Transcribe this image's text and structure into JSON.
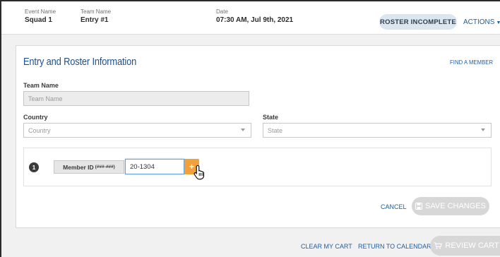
{
  "header": {
    "event_label": "Event Name",
    "event_value": "Squad 1",
    "team_label": "Team Name",
    "team_value": "Entry #1",
    "date_label": "Date",
    "date_value": "07:30 AM, Jul 9th, 2021",
    "status_badge": "ROSTER INCOMPLETE",
    "actions_label": "ACTIONS"
  },
  "card": {
    "title": "Entry and Roster Information",
    "find_member": "FIND A MEMBER",
    "team_name_label": "Team Name",
    "team_name_placeholder": "Team Name",
    "country_label": "Country",
    "country_value": "Country",
    "state_label": "State",
    "state_value": "State"
  },
  "member": {
    "number": "1",
    "label": "Member ID",
    "format": "(###-###)",
    "value": "20-1304",
    "add_symbol": "+"
  },
  "form_actions": {
    "cancel": "CANCEL",
    "save": "SAVE CHANGES"
  },
  "footer": {
    "clear_cart": "CLEAR MY CART",
    "return_calendar": "RETURN TO CALENDAR",
    "review_cart": "REVIEW CART"
  },
  "colors": {
    "link": "#1f5d9c",
    "accent_orange": "#f0a13a",
    "badge_bg": "#dbe6ef",
    "disabled_button": "#d7d7d7"
  }
}
